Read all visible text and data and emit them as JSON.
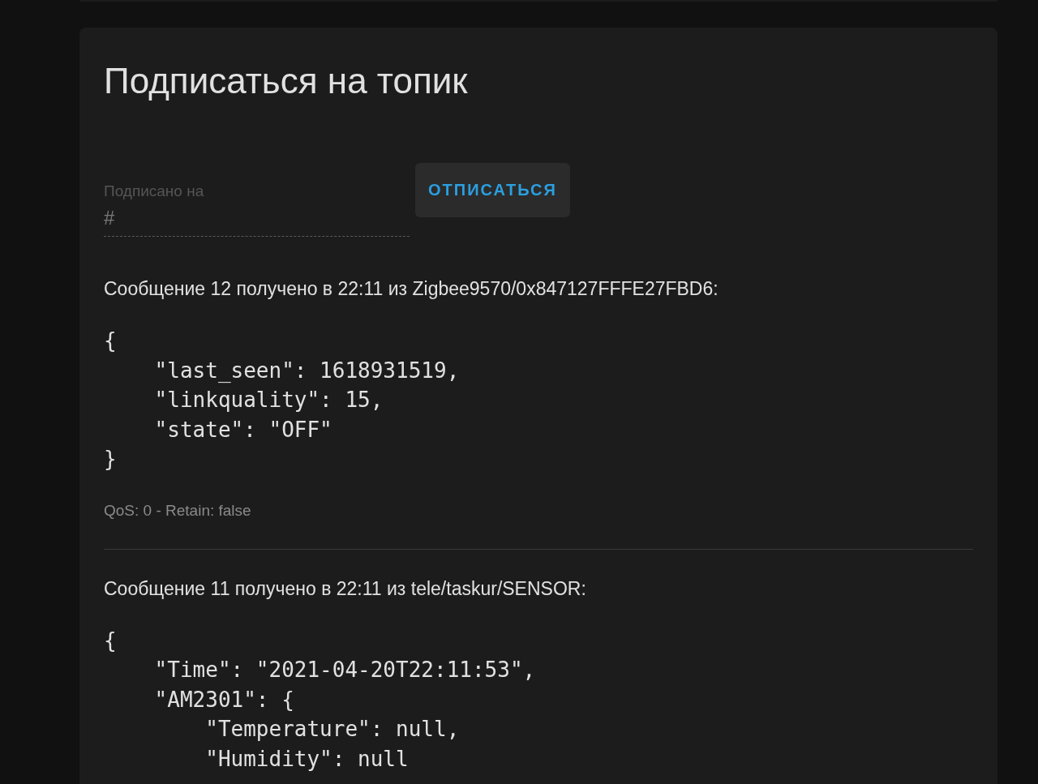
{
  "card": {
    "title": "Подписаться на топик",
    "field": {
      "label": "Подписано на",
      "value": "#"
    },
    "button": "ОТПИСАТЬСЯ",
    "messages": [
      {
        "header": "Сообщение 12 получено в 22:11 из Zigbee9570/0x847127FFFE27FBD6:",
        "payload": "{\n    \"last_seen\": 1618931519,\n    \"linkquality\": 15,\n    \"state\": \"OFF\"\n}",
        "meta": "QoS: 0 - Retain: false"
      },
      {
        "header": "Сообщение 11 получено в 22:11 из tele/taskur/SENSOR:",
        "payload": "{\n    \"Time\": \"2021-04-20T22:11:53\",\n    \"AM2301\": {\n        \"Temperature\": null,\n        \"Humidity\": null"
      }
    ]
  }
}
